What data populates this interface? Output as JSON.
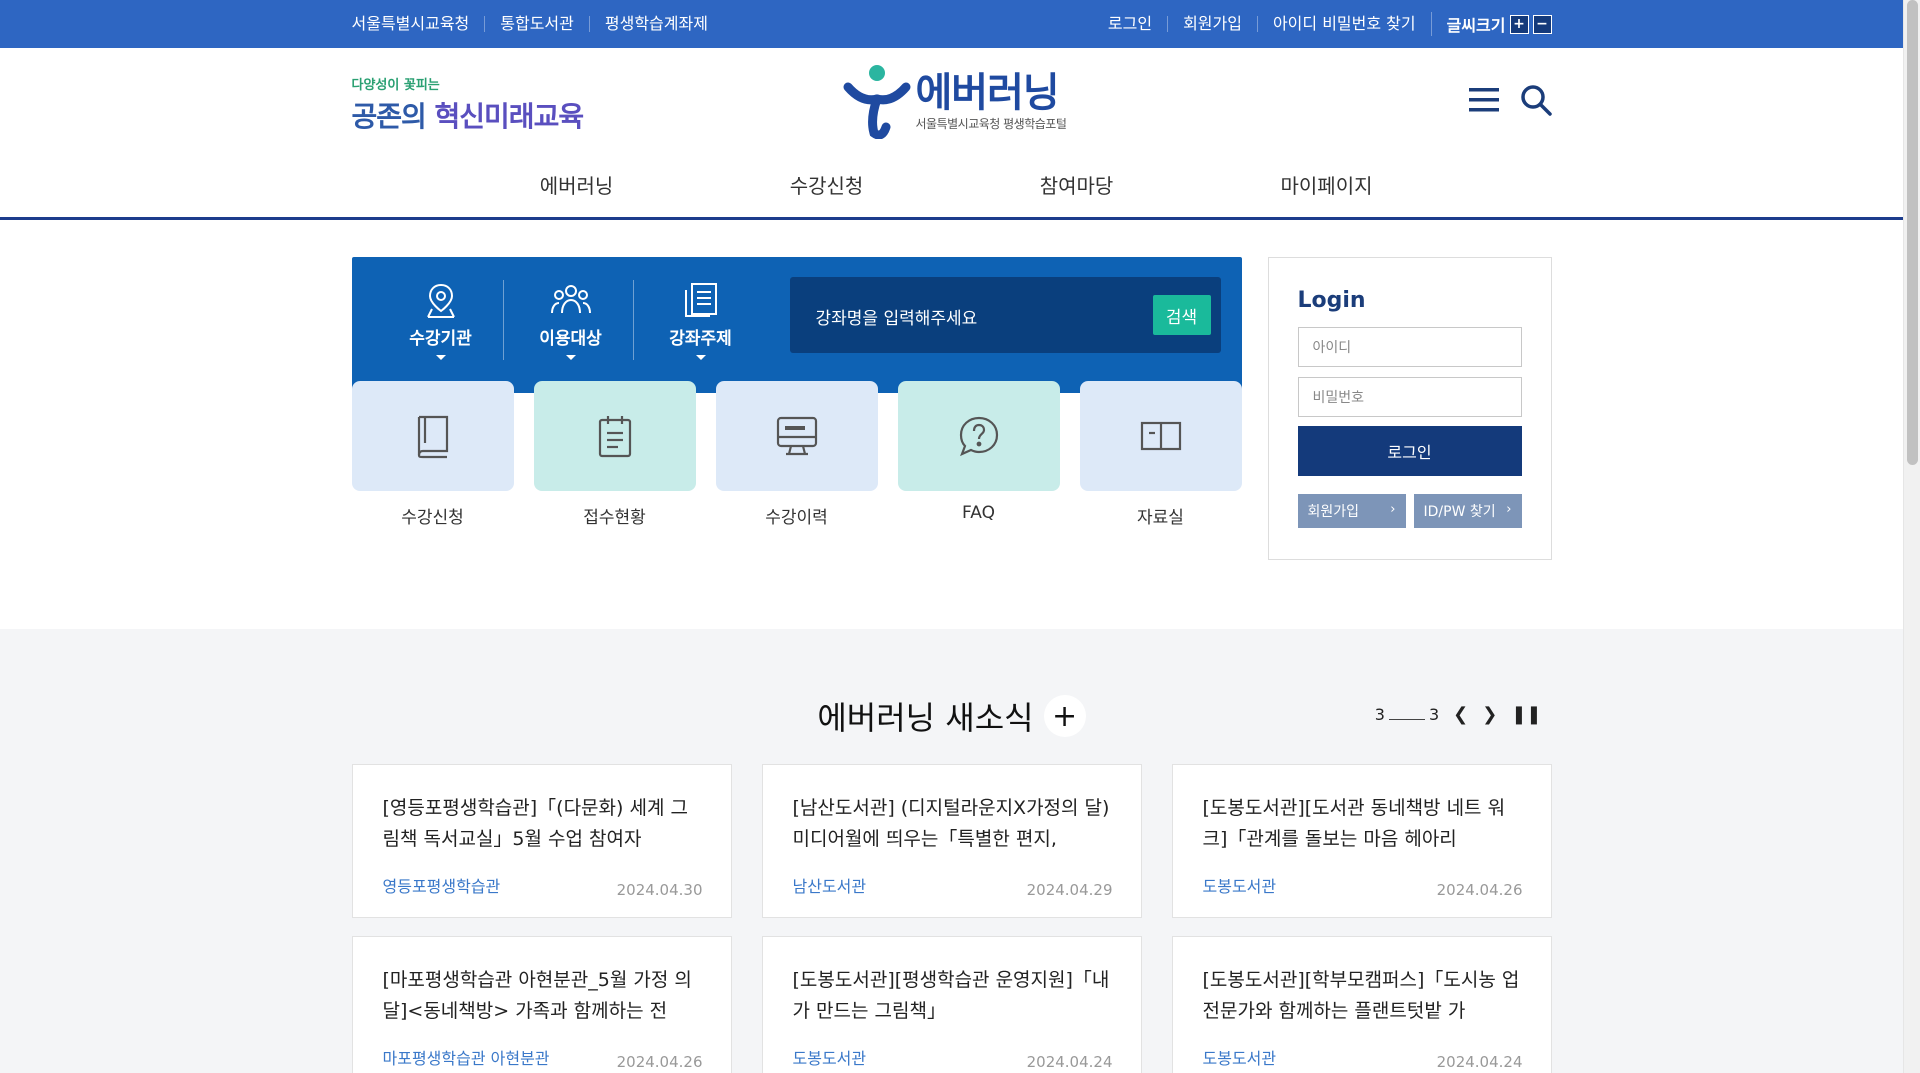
{
  "topbar": {
    "left_links": [
      "서울특별시교육청",
      "통합도서관",
      "평생학습계좌제"
    ],
    "right_links": [
      "로그인",
      "회원가입",
      "아이디 비밀번호 찾기"
    ],
    "font_size_label": "글씨크기",
    "font_plus": "+",
    "font_minus": "−"
  },
  "header": {
    "slogan_small": "다양성이 꽃피는",
    "slogan_big_a": "공존의 ",
    "slogan_big_b": "혁신미래교육",
    "logo_name": "에버러닝",
    "logo_sub": "서울특별시교육청 평생학습포털",
    "gnb": [
      "에버러닝",
      "수강신청",
      "참여마당",
      "마이페이지"
    ]
  },
  "search": {
    "categories": [
      "수강기관",
      "이용대상",
      "강좌주제"
    ],
    "placeholder": "강좌명을 입력해주세요",
    "button": "검색"
  },
  "quick_links": [
    {
      "label": "수강신청",
      "icon": "book-icon",
      "tone": "blue"
    },
    {
      "label": "접수현황",
      "icon": "clipboard-icon",
      "tone": "mint"
    },
    {
      "label": "수강이력",
      "icon": "monitor-icon",
      "tone": "blue"
    },
    {
      "label": "FAQ",
      "icon": "question-bubble-icon",
      "tone": "mint"
    },
    {
      "label": "자료실",
      "icon": "open-book-icon",
      "tone": "blue"
    }
  ],
  "login": {
    "title": "Login",
    "id_placeholder": "아이디",
    "pw_placeholder": "비밀번호",
    "button": "로그인",
    "join": "회원가입",
    "find": "ID/PW 찾기"
  },
  "news": {
    "title": "에버러닝 새소식",
    "plus": "+",
    "pager_current": "3",
    "pager_total": "3",
    "items": [
      {
        "title": "[영등포평생학습관]「(다문화) 세계 그림책 독서교실」5월 수업 참여자",
        "source": "영등포평생학습관",
        "date": "2024.04.30"
      },
      {
        "title": "[남산도서관] (디지털라운지X가정의 달) 미디어월에 띄우는「특별한 편지,",
        "source": "남산도서관",
        "date": "2024.04.29"
      },
      {
        "title": "[도봉도서관][도서관 동네책방 네트 워크]「관계를 돌보는 마음 헤아리",
        "source": "도봉도서관",
        "date": "2024.04.26"
      },
      {
        "title": "[마포평생학습관 아현분관_5월 가정 의달]<동네책방> 가족과 함께하는 전",
        "source": "마포평생학습관 아현분관",
        "date": "2024.04.26"
      },
      {
        "title": "[도봉도서관][평생학습관 운영지원]「내가 만드는 그림책」",
        "source": "도봉도서관",
        "date": "2024.04.24"
      },
      {
        "title": "[도봉도서관][학부모캠퍼스]「도시농 업전문가와 함께하는 플랜트텃밭 가",
        "source": "도봉도서관",
        "date": "2024.04.24"
      }
    ]
  }
}
